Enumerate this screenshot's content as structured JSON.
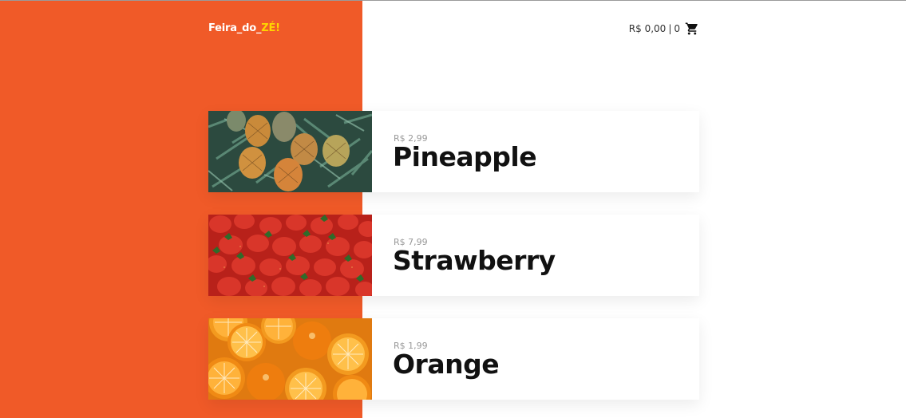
{
  "header": {
    "logo_main": "Feira_do_",
    "logo_accent": "ZÉ!",
    "cart_total": "R$ 0,00",
    "cart_separator": "|",
    "cart_count": "0",
    "cart_icon": "shopping-cart-icon"
  },
  "colors": {
    "brand_orange": "#f05a28",
    "logo_accent": "#ffd400",
    "background": "#ffffff",
    "price_text": "#999999",
    "name_text": "#111111"
  },
  "products": [
    {
      "price": "R$ 2,99",
      "name": "Pineapple",
      "image": "pineapple-photo"
    },
    {
      "price": "R$ 7,99",
      "name": "Strawberry",
      "image": "strawberry-photo"
    },
    {
      "price": "R$ 1,99",
      "name": "Orange",
      "image": "orange-photo"
    }
  ]
}
